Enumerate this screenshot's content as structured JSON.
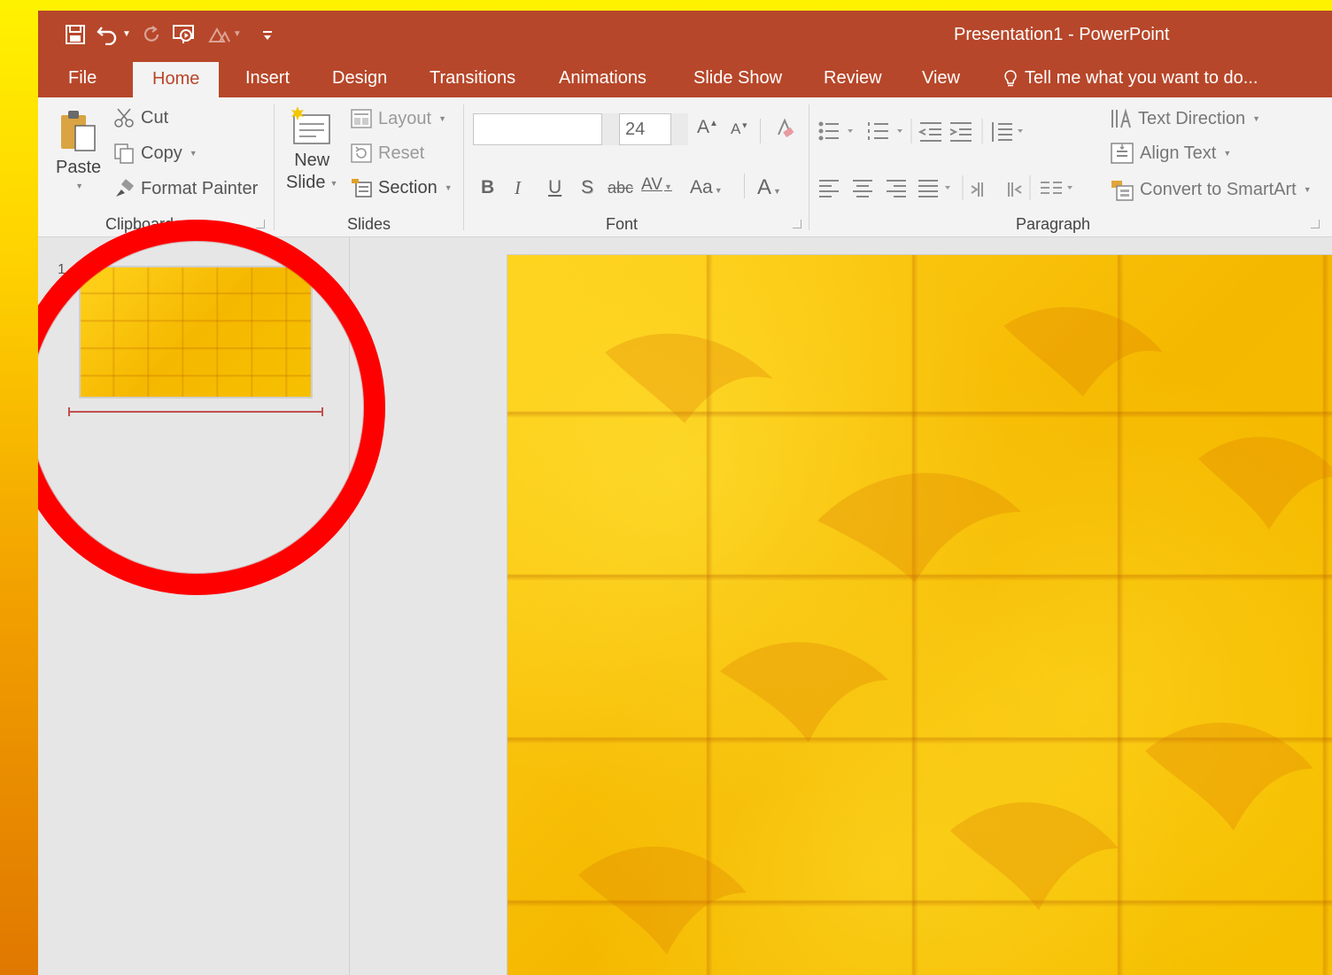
{
  "window": {
    "title": "Presentation1 - PowerPoint"
  },
  "quick_access": {
    "icons": [
      "save-icon",
      "undo-icon",
      "redo-icon",
      "start-from-beginning-icon",
      "accessibility-icon",
      "customize-qat-icon"
    ]
  },
  "tabs": [
    {
      "label": "File"
    },
    {
      "label": "Home",
      "active": true
    },
    {
      "label": "Insert"
    },
    {
      "label": "Design"
    },
    {
      "label": "Transitions"
    },
    {
      "label": "Animations"
    },
    {
      "label": "Slide Show"
    },
    {
      "label": "Review"
    },
    {
      "label": "View"
    }
  ],
  "tell_me": {
    "placeholder": "Tell me what you want to do..."
  },
  "ribbon": {
    "clipboard": {
      "paste": "Paste",
      "cut": "Cut",
      "copy": "Copy",
      "format_painter": "Format Painter",
      "group_label": "Clipboard"
    },
    "slides": {
      "new_slide_line1": "New",
      "new_slide_line2": "Slide",
      "layout": "Layout",
      "reset": "Reset",
      "section": "Section",
      "group_label": "Slides"
    },
    "font": {
      "font_name": "",
      "font_size": "24",
      "increase": "A",
      "decrease": "A",
      "bold": "B",
      "italic": "I",
      "underline": "U",
      "shadow": "S",
      "strikethrough": "abc",
      "spacing": "AV",
      "change_case": "Aa",
      "font_color": "A",
      "group_label": "Font"
    },
    "paragraph": {
      "text_direction": "Text Direction",
      "align_text": "Align Text",
      "convert_smartart": "Convert to SmartArt",
      "group_label": "Paragraph"
    }
  },
  "slides_pane": {
    "slide_number": "1"
  },
  "colors": {
    "accent": "#b7472a",
    "annotation_circle": "#ff0000",
    "background_left": "#ffd400"
  }
}
